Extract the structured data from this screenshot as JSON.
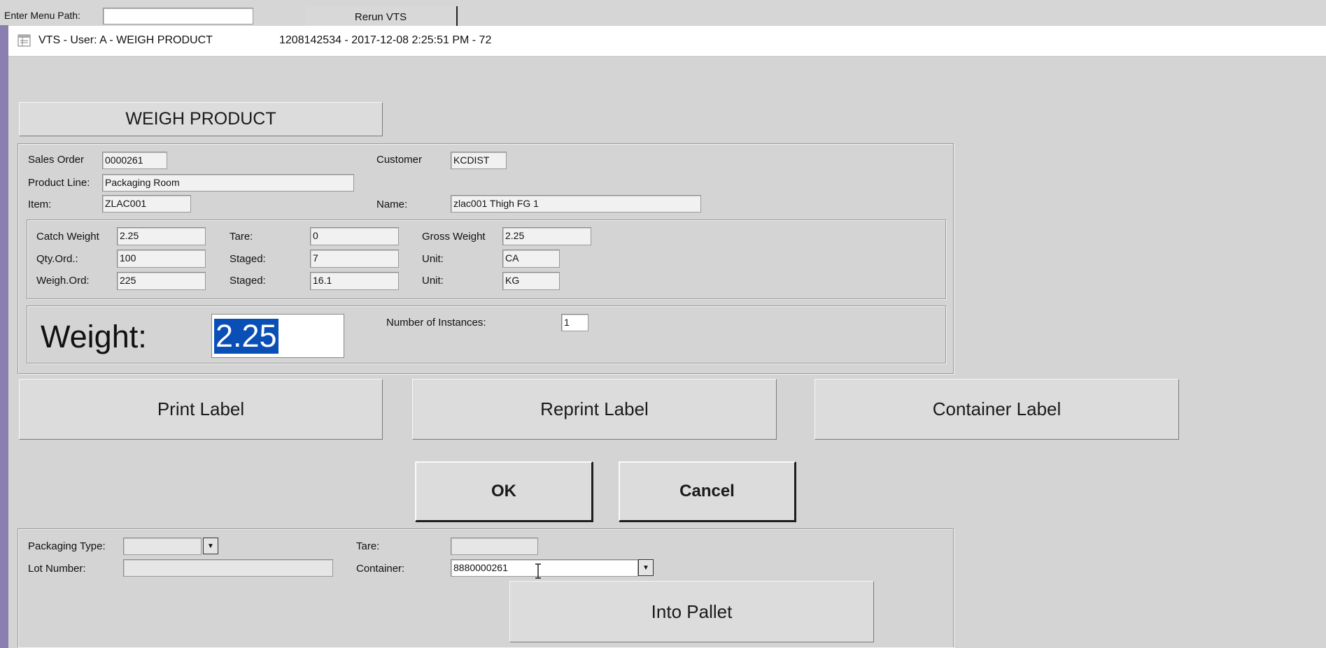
{
  "top_bar": {
    "menu_path_label": "Enter Menu Path:",
    "menu_path_value": "",
    "rerun_label": "Rerun VTS"
  },
  "window": {
    "title": "VTS - User: A - WEIGH PRODUCT",
    "session_info": "1208142534 - 2017-12-08 2:25:51 PM - 72"
  },
  "header_button": "WEIGH PRODUCT",
  "order": {
    "sales_order_label": "Sales Order",
    "sales_order": "0000261",
    "customer_label": "Customer",
    "customer": "KCDIST",
    "product_line_label": "Product Line:",
    "product_line": "Packaging Room",
    "item_label": "Item:",
    "item": "ZLAC001",
    "name_label": "Name:",
    "name": "zlac001 Thigh FG 1"
  },
  "weights": {
    "catch_weight_label": "Catch Weight",
    "catch_weight": "2.25",
    "tare_label": "Tare:",
    "tare": "0",
    "gross_weight_label": "Gross Weight",
    "gross_weight": "2.25",
    "qty_ord_label": "Qty.Ord.:",
    "qty_ord": "100",
    "staged1_label": "Staged:",
    "staged1": "7",
    "unit1_label": "Unit:",
    "unit1": "CA",
    "weigh_ord_label": "Weigh.Ord:",
    "weigh_ord": "225",
    "staged2_label": "Staged:",
    "staged2": "16.1",
    "unit2_label": "Unit:",
    "unit2": "KG"
  },
  "weigh": {
    "weight_label": "Weight:",
    "weight_value": "2.25",
    "instances_label": "Number of Instances:",
    "instances": "1"
  },
  "label_buttons": {
    "print": "Print Label",
    "reprint": "Reprint Label",
    "container": "Container Label"
  },
  "dialog_buttons": {
    "ok": "OK",
    "cancel": "Cancel"
  },
  "packaging": {
    "packaging_type_label": "Packaging Type:",
    "packaging_type": "",
    "tare_label": "Tare:",
    "tare": "",
    "lot_number_label": "Lot Number:",
    "lot_number": "",
    "container_label": "Container:",
    "container": "8880000261",
    "into_pallet": "Into Pallet"
  }
}
